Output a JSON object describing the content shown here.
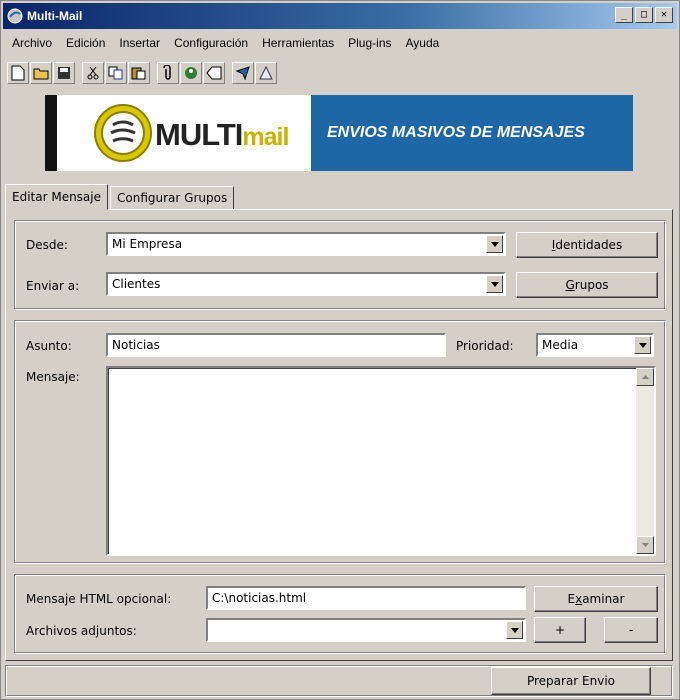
{
  "window": {
    "title": "Multi-Mail"
  },
  "menu": [
    "Archivo",
    "Edición",
    "Insertar",
    "Configuración",
    "Herramientas",
    "Plug-ins",
    "Ayuda"
  ],
  "banner": {
    "logo_main": "MULTI",
    "logo_accent": "mail",
    "tagline": "ENVIOS MASIVOS DE MENSAJES"
  },
  "tabs": [
    "Editar Mensaje",
    "Configurar Grupos"
  ],
  "form": {
    "desde_label": "Desde:",
    "desde_value": "Mi Empresa",
    "enviar_label": "Enviar a:",
    "enviar_value": "Clientes",
    "identidades_btn": "dentidades",
    "identidades_key": "I",
    "grupos_btn": "rupos",
    "grupos_key": "G",
    "asunto_label": "Asunto:",
    "asunto_value": "Noticias",
    "prioridad_label": "Prioridad:",
    "prioridad_value": "Media",
    "mensaje_label": "Mensaje:",
    "html_label": "Mensaje HTML opcional:",
    "html_value": "C:\\noticias.html",
    "examinar_pre": "E",
    "examinar_key": "x",
    "examinar_post": "aminar",
    "adjuntos_label": "Archivos adjuntos:",
    "plus_btn": "+",
    "minus_btn": "-"
  },
  "footer": {
    "preparar_btn": "Preparar Envio"
  },
  "colors": {
    "titlebar": "#0a246a",
    "banner_blue": "#1e67a6",
    "face": "#d4d0c8"
  }
}
